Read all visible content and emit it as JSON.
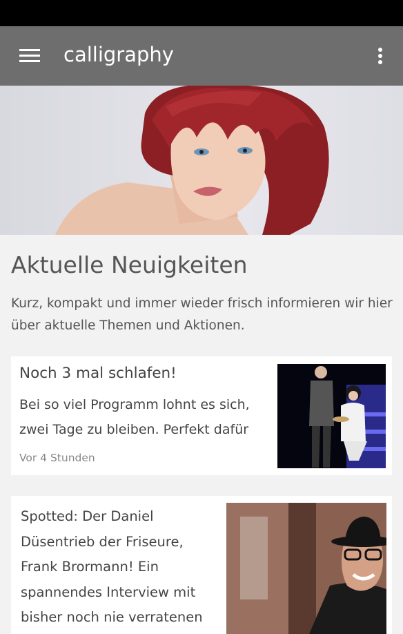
{
  "app_bar": {
    "title": "calligraphy",
    "menu_icon": "hamburger-menu-icon",
    "overflow_icon": "more-vertical-icon",
    "color": "#6e6e6e"
  },
  "hero": {
    "image": "woman with red hair portrait"
  },
  "section": {
    "title": "Aktuelle Neuigkeiten",
    "description": "Kurz, kompakt und immer wieder frisch informieren wir hier über aktuelle Themen und Aktionen."
  },
  "news": [
    {
      "title": "Noch 3 mal schlafen!",
      "snippet": "Bei so viel Programm lohnt es sich, zwei Tage zu bleiben. Perfekt dafür",
      "time": "Vor 4 Stunden",
      "image": "hairdresser styling model on stage"
    },
    {
      "title": "Spotted: Der Daniel Düsentrieb der Friseure, Frank Brormann! Ein spannendes Interview mit bisher noch nie verratenen",
      "image": "smiling man with black hat and glasses"
    }
  ]
}
